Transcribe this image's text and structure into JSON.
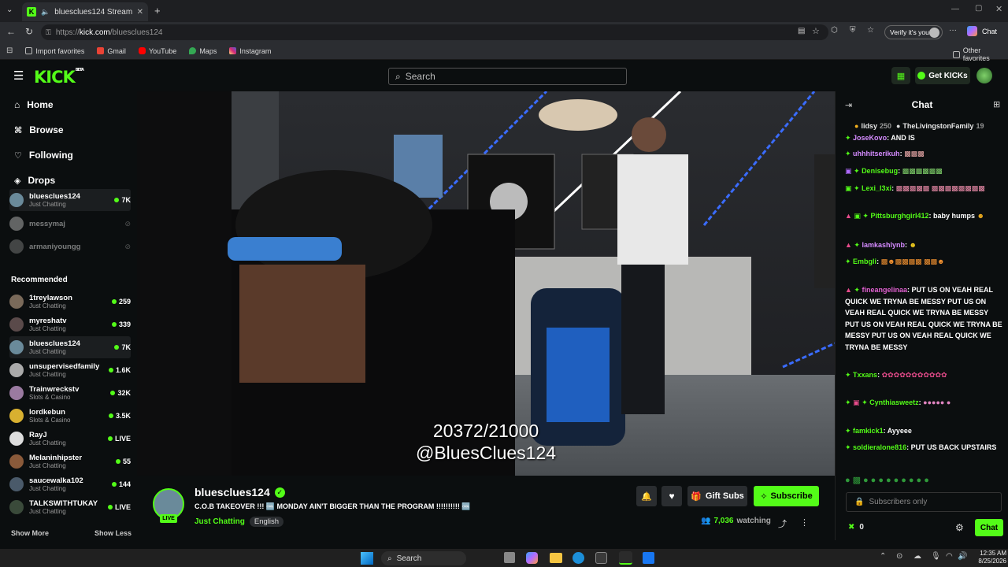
{
  "browser": {
    "tab_title": "bluesclues124 Stream - Watch",
    "url_prefix": "https://",
    "url_domain": "kick.com",
    "url_path": "/bluesclues124",
    "verify": "Verify it's you",
    "chat_btn": "Chat",
    "bookmarks": [
      "Import favorites",
      "Gmail",
      "YouTube",
      "Maps",
      "Instagram"
    ],
    "other_favorites": "Other favorites"
  },
  "header": {
    "logo": "KICK",
    "logo_beta": "BETA",
    "search_placeholder": "Search",
    "get_kicks": "Get KICKs"
  },
  "sidebar": {
    "nav": [
      "Home",
      "Browse",
      "Following",
      "Drops"
    ],
    "following": [
      {
        "name": "bluesclues124",
        "cat": "Just Chatting",
        "viewers": "7K",
        "live": true
      },
      {
        "name": "messymaj",
        "cat": "",
        "viewers": "",
        "live": false
      },
      {
        "name": "armaniyoungg",
        "cat": "",
        "viewers": "",
        "live": false
      }
    ],
    "recommended_label": "Recommended",
    "recommended": [
      {
        "name": "1treylawson",
        "cat": "Just Chatting",
        "viewers": "259"
      },
      {
        "name": "myreshatv",
        "cat": "Just Chatting",
        "viewers": "339"
      },
      {
        "name": "bluesclues124",
        "cat": "Just Chatting",
        "viewers": "7K"
      },
      {
        "name": "unsupervisedfamily",
        "cat": "Just Chatting",
        "viewers": "1.6K"
      },
      {
        "name": "Trainwreckstv",
        "cat": "Slots & Casino",
        "viewers": "32K"
      },
      {
        "name": "lordkebun",
        "cat": "Slots & Casino",
        "viewers": "3.5K"
      },
      {
        "name": "RayJ",
        "cat": "Just Chatting",
        "viewers": "LIVE"
      },
      {
        "name": "Melaninhipster",
        "cat": "Just Chatting",
        "viewers": "55"
      },
      {
        "name": "saucewalka102",
        "cat": "Just Chatting",
        "viewers": "144"
      },
      {
        "name": "TALKSWITHTUKAY",
        "cat": "Just Chatting",
        "viewers": "LIVE"
      }
    ],
    "show_more": "Show More",
    "show_less": "Show Less"
  },
  "video": {
    "overlay_count": "20372/21000",
    "overlay_handle": "@BluesClues124"
  },
  "stream": {
    "channel": "bluesclues124",
    "title": "C.O.B TAKEOVER !!! 🆒 MONDAY AIN'T BIGGER THAN THE PROGRAM !!!!!!!!!! 🆒",
    "category": "Just Chatting",
    "language": "English",
    "live_badge": "LIVE",
    "viewers": "7,036",
    "viewers_label": "watching",
    "gift_subs": "Gift Subs",
    "subscribe": "Subscribe"
  },
  "chat": {
    "title": "Chat",
    "pinned": [
      {
        "user": "lidsy",
        "count": "250"
      },
      {
        "user": "TheLivingstonFamily",
        "count": "19"
      }
    ],
    "messages": [
      {
        "user": "JoseKovo",
        "text": "AND IS"
      },
      {
        "user": "uhhhitserikuh",
        "text": ""
      },
      {
        "user": "Denisebug",
        "text": ""
      },
      {
        "user": "Lexi_I3xi",
        "text": ""
      },
      {
        "user": "Pittsburghgirl412",
        "text": "baby humps"
      },
      {
        "user": "lamkashlynb",
        "text": ""
      },
      {
        "user": "Embgli",
        "text": ""
      },
      {
        "user": "fineangelinaa",
        "text": "PUT US ON VEAH REAL QUICK WE TRYNA BE MESSY PUT US ON VEAH REAL QUICK WE TRYNA BE MESSY PUT US ON VEAH REAL QUICK WE TRYNA BE MESSY PUT US ON VEAH REAL QUICK WE TRYNA BE MESSY"
      },
      {
        "user": "Txxans",
        "text": ""
      },
      {
        "user": "Cynthiasweetz",
        "text": ""
      },
      {
        "user": "famkick1",
        "text": "Ayyeee"
      },
      {
        "user": "soldieralone816",
        "text": "PUT US BACK UPSTAIRS"
      }
    ],
    "input_placeholder": "Subscribers only",
    "kicks_count": "0",
    "send": "Chat"
  },
  "taskbar": {
    "search": "Search",
    "time": "12:35 AM",
    "date": "8/25/2026"
  },
  "colors": {
    "accent": "#53fc18",
    "bg": "#0b0e0f"
  }
}
